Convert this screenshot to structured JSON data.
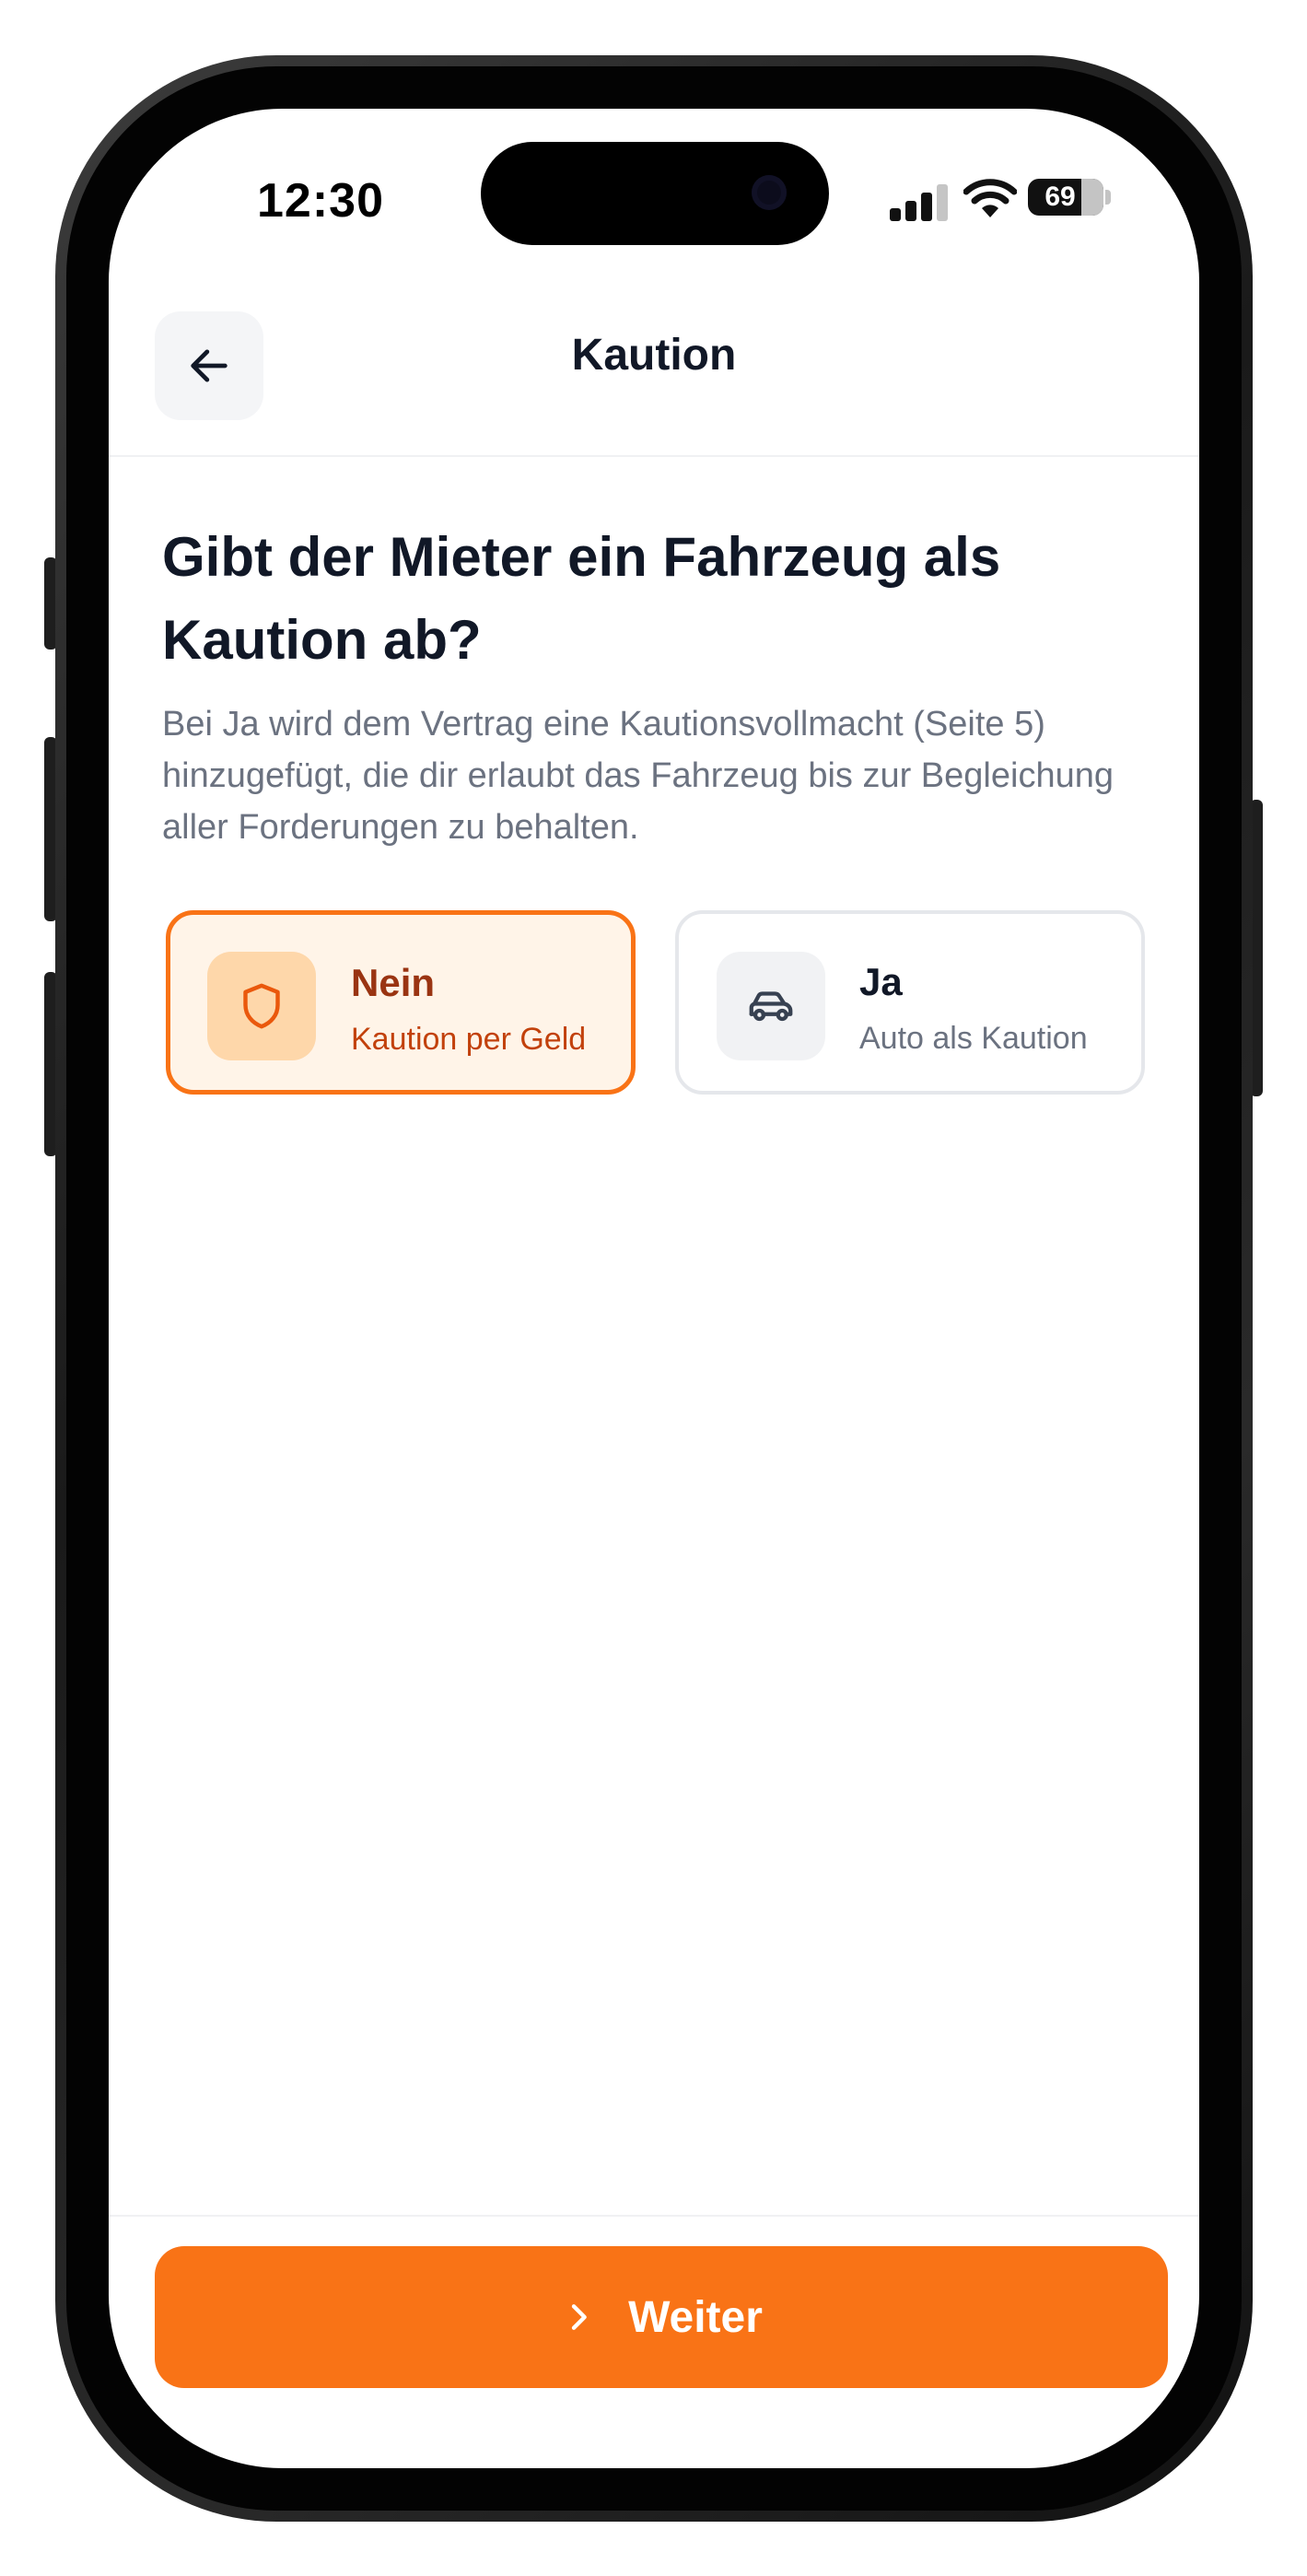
{
  "status_bar": {
    "time": "12:30",
    "battery": "69",
    "icons": [
      "cellular-signal-icon",
      "wifi-icon",
      "battery-icon"
    ]
  },
  "header": {
    "title": "Kaution",
    "back_icon": "arrow-left-icon"
  },
  "question": {
    "title": "Gibt der Mieter ein Fahrzeug als Kaution ab?",
    "description": "Bei Ja wird dem Vertrag eine Kautionsvollmacht (Seite 5) hinzugefügt, die dir erlaubt das Fahrzeug bis zur Begleichung aller Forderungen zu behalten."
  },
  "options": [
    {
      "title": "Nein",
      "subtitle": "Kaution per Geld",
      "icon": "shield-icon",
      "selected": true
    },
    {
      "title": "Ja",
      "subtitle": "Auto als Kaution",
      "icon": "car-icon",
      "selected": false
    }
  ],
  "footer": {
    "next_label": "Weiter",
    "next_icon": "chevron-right-icon"
  },
  "colors": {
    "accent": "#f97316",
    "selected_bg": "#fff4e8",
    "heading": "#111827",
    "muted": "#6b7280"
  }
}
